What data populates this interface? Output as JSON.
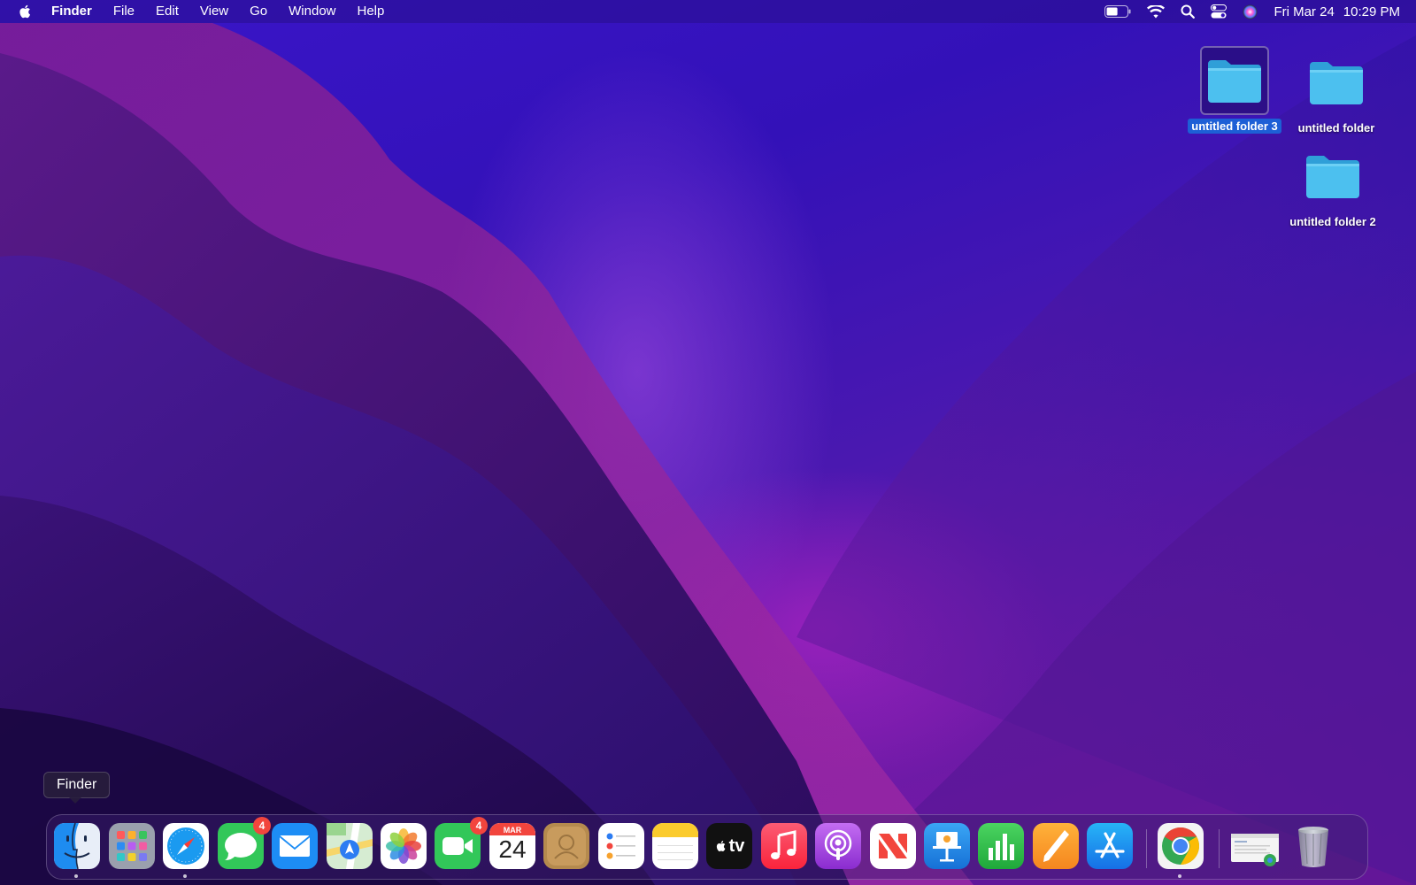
{
  "menubar": {
    "app_name": "Finder",
    "items": [
      "File",
      "Edit",
      "View",
      "Go",
      "Window",
      "Help"
    ],
    "date": "Fri Mar 24",
    "time": "10:29 PM",
    "battery_level": 0.55,
    "status_icons": [
      "battery-icon",
      "wifi-icon",
      "spotlight-search-icon",
      "control-center-icon",
      "siri-icon"
    ]
  },
  "desktop": {
    "icons": [
      {
        "label": "untitled folder 3",
        "selected": true
      },
      {
        "label": "untitled folder",
        "selected": false
      },
      {
        "label": "untitled folder 2",
        "selected": false
      }
    ]
  },
  "tooltip": {
    "text": "Finder"
  },
  "dock": {
    "apps": [
      {
        "name": "Finder",
        "icon": "finder-icon",
        "running": true
      },
      {
        "name": "Launchpad",
        "icon": "launchpad-icon"
      },
      {
        "name": "Safari",
        "icon": "safari-icon",
        "running": true
      },
      {
        "name": "Messages",
        "icon": "messages-icon",
        "badge": "4"
      },
      {
        "name": "Mail",
        "icon": "mail-icon"
      },
      {
        "name": "Maps",
        "icon": "maps-icon"
      },
      {
        "name": "Photos",
        "icon": "photos-icon"
      },
      {
        "name": "FaceTime",
        "icon": "facetime-icon",
        "badge": "4"
      },
      {
        "name": "Calendar",
        "icon": "calendar-icon",
        "month": "MAR",
        "day": "24"
      },
      {
        "name": "Contacts",
        "icon": "contacts-icon"
      },
      {
        "name": "Reminders",
        "icon": "reminders-icon"
      },
      {
        "name": "Notes",
        "icon": "notes-icon"
      },
      {
        "name": "TV",
        "icon": "apple-tv-icon",
        "text": "tv"
      },
      {
        "name": "Music",
        "icon": "music-icon"
      },
      {
        "name": "Podcasts",
        "icon": "podcasts-icon"
      },
      {
        "name": "News",
        "icon": "news-icon"
      },
      {
        "name": "Keynote",
        "icon": "keynote-icon"
      },
      {
        "name": "Numbers",
        "icon": "numbers-icon"
      },
      {
        "name": "Pages",
        "icon": "pages-icon"
      },
      {
        "name": "App Store",
        "icon": "app-store-icon"
      },
      {
        "name": "Google Chrome",
        "icon": "chrome-icon",
        "running": true
      },
      {
        "name": "Recent Window",
        "icon": "window-thumbnail-icon"
      },
      {
        "name": "Trash",
        "icon": "trash-icon"
      }
    ]
  },
  "colors": {
    "selection": "#1d5fd6",
    "badge": "#f2453d",
    "folder": "#4cc0ef"
  }
}
